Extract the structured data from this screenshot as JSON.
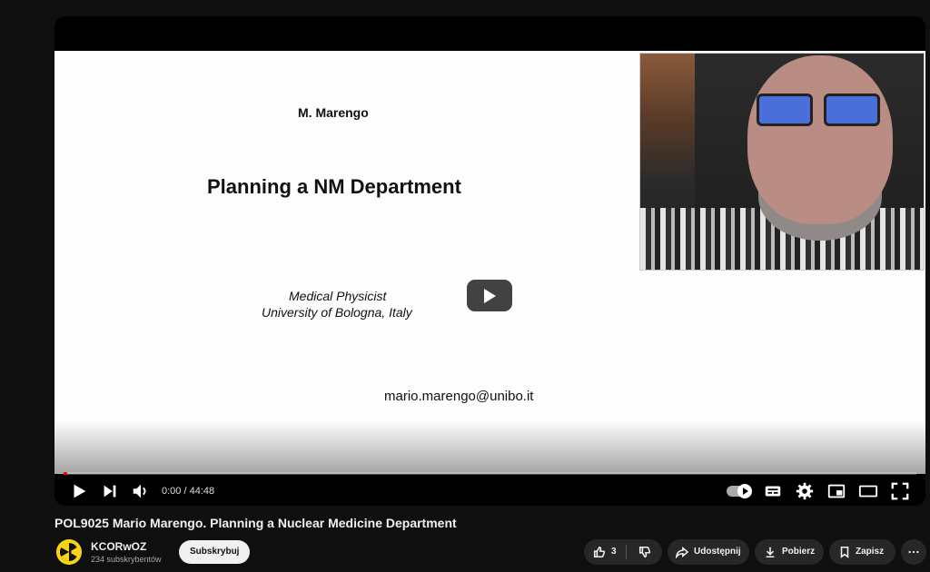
{
  "slide": {
    "author": "M. Marengo",
    "title": "Planning a NM Department",
    "role": "Medical Physicist",
    "affiliation": "University of Bologna, Italy",
    "email": "mario.marengo@unibo.it"
  },
  "player": {
    "time": "0:00 / 44:48",
    "progress": 0.0,
    "accent": "#ff0000"
  },
  "video": {
    "title": "POL9025 Mario Marengo. Planning a Nuclear Medicine Department"
  },
  "channel": {
    "name": "KCORwOZ",
    "subscribers": "234 subskrybentów",
    "subscribe_label": "Subskrybuj"
  },
  "actions": {
    "likes": "3",
    "share_label": "Udostępnij",
    "download_label": "Pobierz",
    "save_label": "Zapisz"
  }
}
